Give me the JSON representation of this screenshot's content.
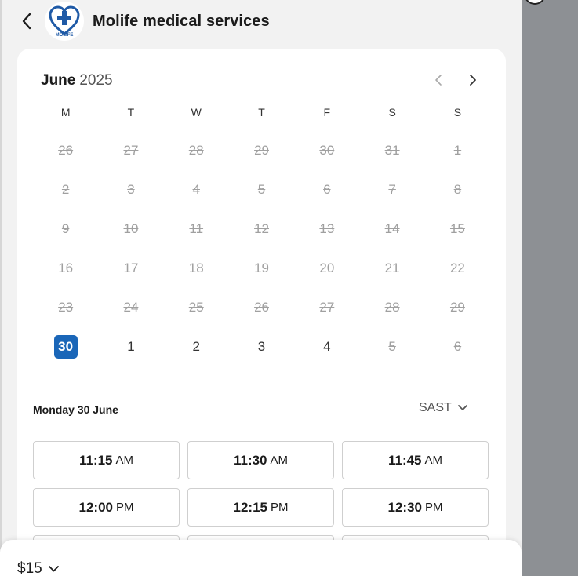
{
  "header": {
    "title": "Molife medical services",
    "logo_text": "MOLIFE"
  },
  "calendar": {
    "month": "June",
    "year": "2025",
    "weekdays": [
      "M",
      "T",
      "W",
      "T",
      "F",
      "S",
      "S"
    ],
    "days": [
      {
        "d": "26",
        "s": "disabled"
      },
      {
        "d": "27",
        "s": "disabled"
      },
      {
        "d": "28",
        "s": "disabled"
      },
      {
        "d": "29",
        "s": "disabled"
      },
      {
        "d": "30",
        "s": "disabled"
      },
      {
        "d": "31",
        "s": "disabled"
      },
      {
        "d": "1",
        "s": "disabled"
      },
      {
        "d": "2",
        "s": "disabled"
      },
      {
        "d": "3",
        "s": "disabled"
      },
      {
        "d": "4",
        "s": "disabled"
      },
      {
        "d": "5",
        "s": "disabled"
      },
      {
        "d": "6",
        "s": "disabled"
      },
      {
        "d": "7",
        "s": "disabled"
      },
      {
        "d": "8",
        "s": "disabled"
      },
      {
        "d": "9",
        "s": "disabled"
      },
      {
        "d": "10",
        "s": "disabled"
      },
      {
        "d": "11",
        "s": "disabled"
      },
      {
        "d": "12",
        "s": "disabled"
      },
      {
        "d": "13",
        "s": "disabled"
      },
      {
        "d": "14",
        "s": "disabled"
      },
      {
        "d": "15",
        "s": "disabled"
      },
      {
        "d": "16",
        "s": "disabled"
      },
      {
        "d": "17",
        "s": "disabled"
      },
      {
        "d": "18",
        "s": "disabled"
      },
      {
        "d": "19",
        "s": "disabled"
      },
      {
        "d": "20",
        "s": "disabled"
      },
      {
        "d": "21",
        "s": "disabled"
      },
      {
        "d": "22",
        "s": "disabled"
      },
      {
        "d": "23",
        "s": "disabled"
      },
      {
        "d": "24",
        "s": "disabled"
      },
      {
        "d": "25",
        "s": "disabled"
      },
      {
        "d": "26",
        "s": "disabled"
      },
      {
        "d": "27",
        "s": "disabled"
      },
      {
        "d": "28",
        "s": "disabled"
      },
      {
        "d": "29",
        "s": "disabled"
      },
      {
        "d": "30",
        "s": "selected"
      },
      {
        "d": "1",
        "s": "available"
      },
      {
        "d": "2",
        "s": "available"
      },
      {
        "d": "3",
        "s": "available"
      },
      {
        "d": "4",
        "s": "available"
      },
      {
        "d": "5",
        "s": "disabled"
      },
      {
        "d": "6",
        "s": "disabled"
      }
    ]
  },
  "selection": {
    "date_label": "Monday 30 June",
    "timezone": "SAST"
  },
  "slots": [
    {
      "time": "11:15",
      "ampm": "AM"
    },
    {
      "time": "11:30",
      "ampm": "AM"
    },
    {
      "time": "11:45",
      "ampm": "AM"
    },
    {
      "time": "12:00",
      "ampm": "PM"
    },
    {
      "time": "12:15",
      "ampm": "PM"
    },
    {
      "time": "12:30",
      "ampm": "PM"
    }
  ],
  "footer": {
    "price": "$15"
  },
  "colors": {
    "accent": "#1a66b8",
    "panel_bg": "#f2f2f2",
    "overlay": "#8d9094"
  }
}
